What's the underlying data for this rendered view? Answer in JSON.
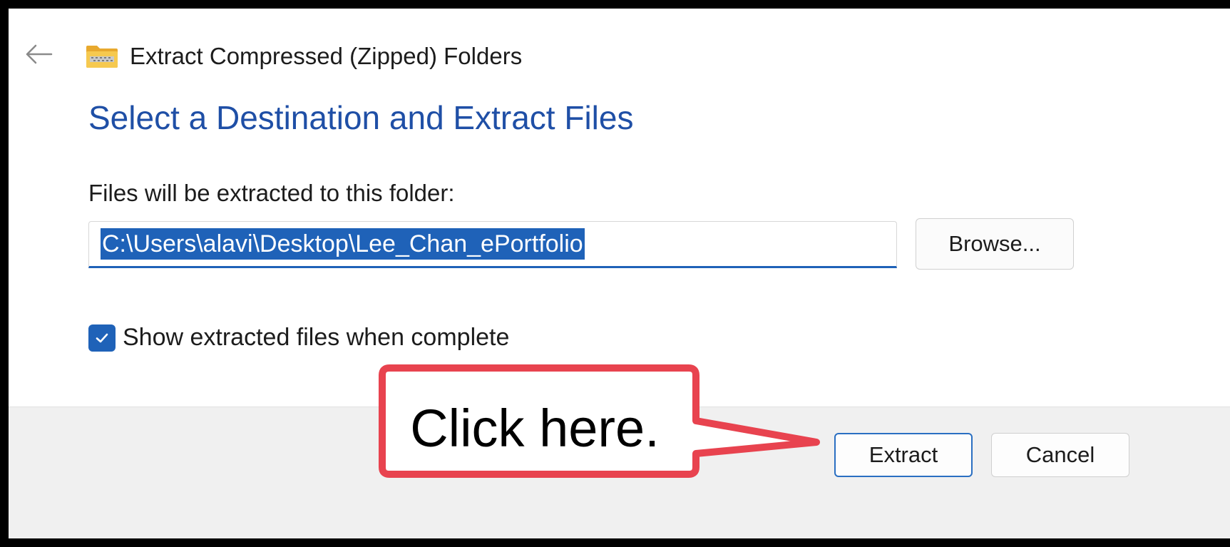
{
  "window": {
    "title": "Extract Compressed (Zipped) Folders",
    "back_icon": "back-arrow-icon",
    "app_icon": "zipped-folder-icon"
  },
  "main": {
    "heading": "Select a Destination and Extract Files",
    "destination_label": "Files will be extracted to this folder:",
    "destination_value": "C:\\Users\\alavi\\Desktop\\Lee_Chan_ePortfolio",
    "browse_label": "Browse...",
    "show_files_checkbox": {
      "label": "Show extracted files when complete",
      "checked": true
    }
  },
  "footer": {
    "extract_label": "Extract",
    "cancel_label": "Cancel"
  },
  "annotation": {
    "callout_text": "Click here.",
    "callout_color": "#e8434f"
  },
  "colors": {
    "accent": "#1f62b8",
    "heading": "#1f4fa6",
    "footer_bg": "#f0f0f0"
  }
}
